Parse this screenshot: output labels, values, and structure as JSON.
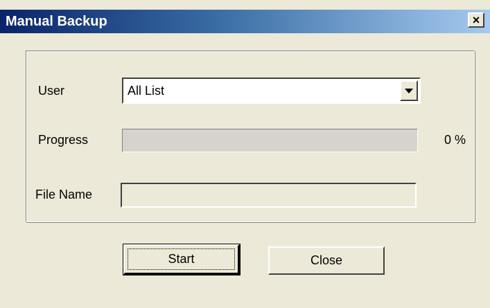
{
  "window": {
    "title": "Manual Backup",
    "close_glyph": "×",
    "close_icon": "close-icon"
  },
  "form": {
    "user_label": "User",
    "user_value": "All List",
    "progress_label": "Progress",
    "progress_value": 0,
    "progress_text": "0 %",
    "file_name_label": "File Name",
    "file_name_value": ""
  },
  "buttons": {
    "start_label": "Start",
    "close_label": "Close"
  },
  "colors": {
    "titlebar_start": "#0a246a",
    "titlebar_end": "#a6caf0",
    "dialog_bg": "#ece9d8"
  }
}
